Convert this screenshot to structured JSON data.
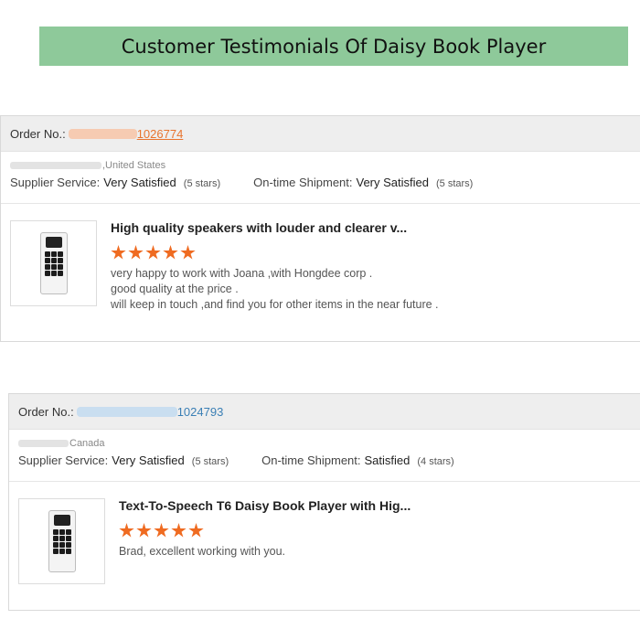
{
  "banner": {
    "title": "Customer Testimonials Of Daisy Book Player"
  },
  "colors": {
    "banner_bg": "#8ec99a",
    "star": "#ef6b21",
    "order_link_orange": "#e8742e",
    "order_link_blue": "#3a7fb5"
  },
  "reviews": [
    {
      "order_label": "Order No.:",
      "order_number_visible": "1026774",
      "buyer_location": ",United States",
      "supplier_service_label": "Supplier Service:",
      "supplier_service_value": "Very Satisfied",
      "supplier_service_stars": "(5 stars)",
      "shipment_label": "On-time Shipment:",
      "shipment_value": "Very Satisfied",
      "shipment_stars": "(5 stars)",
      "product_title": "High quality speakers with louder and clearer v...",
      "rating": 5,
      "text_lines": [
        "very happy to work with Joana ,with Hongdee corp .",
        "good quality at the price .",
        "will keep in touch ,and find you for other items in the near future ."
      ],
      "thumbnail_icon": "daisy-player-device-icon"
    },
    {
      "order_label": "Order No.:",
      "order_number_visible": "1024793",
      "buyer_location": "Canada",
      "supplier_service_label": "Supplier Service:",
      "supplier_service_value": "Very Satisfied",
      "supplier_service_stars": "(5 stars)",
      "shipment_label": "On-time Shipment:",
      "shipment_value": "Satisfied",
      "shipment_stars": "(4 stars)",
      "product_title": "Text-To-Speech T6 Daisy Book Player with Hig...",
      "rating": 5,
      "text_lines": [
        "Brad, excellent working with you."
      ],
      "thumbnail_icon": "daisy-player-device-icon"
    }
  ]
}
